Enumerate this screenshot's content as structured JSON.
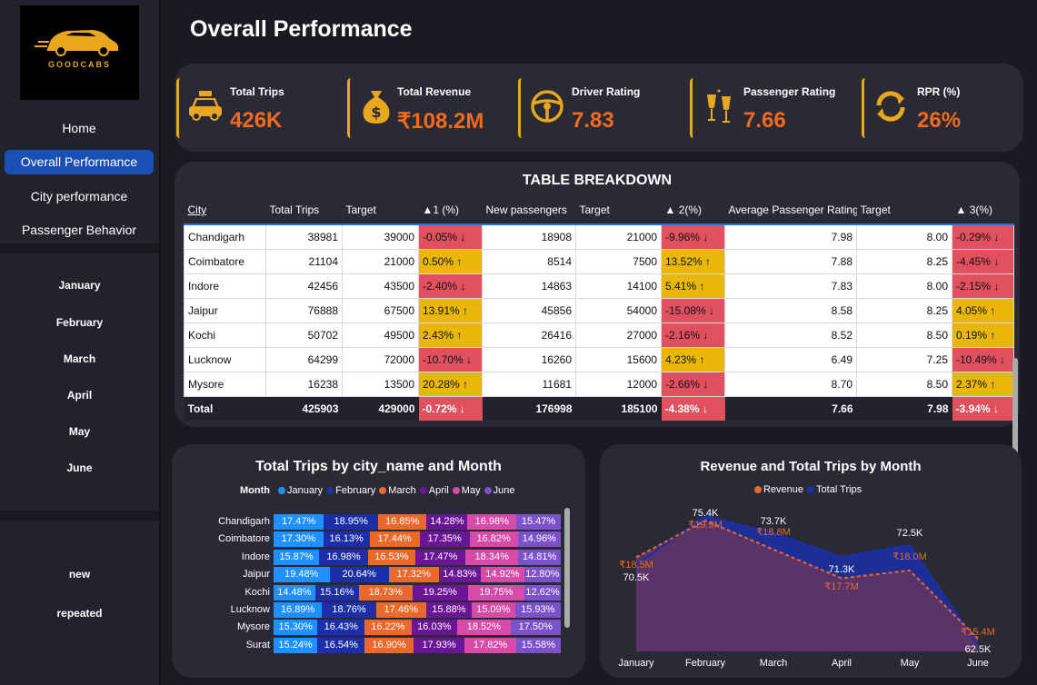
{
  "brand": {
    "wordmark": "GOODCABS"
  },
  "nav": [
    {
      "label": "Home",
      "active": false
    },
    {
      "label": "Overall Performance",
      "active": true
    },
    {
      "label": "City performance",
      "active": false
    },
    {
      "label": "Passenger Behavior",
      "active": false
    }
  ],
  "months": [
    "January",
    "February",
    "March",
    "April",
    "May",
    "June"
  ],
  "passenger_types": [
    "new",
    "repeated"
  ],
  "page_title": "Overall Performance",
  "kpis": [
    {
      "label": "Total Trips",
      "value": "426K",
      "icon": "taxi-icon"
    },
    {
      "label": "Total Revenue",
      "value": "₹108.2M",
      "icon": "money-bag-icon"
    },
    {
      "label": "Driver Rating",
      "value": "7.83",
      "icon": "steering-wheel-icon"
    },
    {
      "label": "Passenger Rating",
      "value": "7.66",
      "icon": "champagne-icon"
    },
    {
      "label": "RPR (%)",
      "value": "26%",
      "icon": "refresh-icon"
    }
  ],
  "table": {
    "title": "TABLE BREAKDOWN",
    "headers": [
      "City",
      "Total Trips",
      "Target",
      "▲1 (%)",
      "New passengers",
      "Target",
      "▲ 2(%)",
      "Average Passenger Rating",
      "Target",
      "▲ 3(%)"
    ],
    "rows": [
      [
        "Chandigarh",
        "38981",
        "39000",
        "-0.05% ↓",
        "18908",
        "21000",
        "-9.96% ↓",
        "7.98",
        "8.00",
        "-0.29% ↓"
      ],
      [
        "Coimbatore",
        "21104",
        "21000",
        "0.50% ↑",
        "8514",
        "7500",
        "13.52% ↑",
        "7.88",
        "8.25",
        "-4.45% ↓"
      ],
      [
        "Indore",
        "42456",
        "43500",
        "-2.40% ↓",
        "14863",
        "14100",
        "5.41% ↑",
        "7.83",
        "8.00",
        "-2.15% ↓"
      ],
      [
        "Jaipur",
        "76888",
        "67500",
        "13.91% ↑",
        "45856",
        "54000",
        "-15.08% ↓",
        "8.58",
        "8.25",
        "4.05% ↑"
      ],
      [
        "Kochi",
        "50702",
        "49500",
        "2.43% ↑",
        "26416",
        "27000",
        "-2.16% ↓",
        "8.52",
        "8.50",
        "0.19% ↑"
      ],
      [
        "Lucknow",
        "64299",
        "72000",
        "-10.70% ↓",
        "16260",
        "15600",
        "4.23% ↑",
        "6.49",
        "7.25",
        "-10.49% ↓"
      ],
      [
        "Mysore",
        "16238",
        "13500",
        "20.28% ↑",
        "11681",
        "12000",
        "-2.66% ↓",
        "8.70",
        "8.50",
        "2.37% ↑"
      ]
    ],
    "total": [
      "Total",
      "425903",
      "429000",
      "-0.72% ↓",
      "176998",
      "185100",
      "-4.38% ↓",
      "7.66",
      "7.98",
      "-3.94% ↓"
    ]
  },
  "colors": {
    "positive": "#e8b70a",
    "negative": "#e0505e",
    "kpi_value": "#f26a1b",
    "accent": "#e8a71c",
    "active_nav": "#1a4fb4"
  },
  "chart_data": [
    {
      "type": "bar",
      "title": "Total Trips by city_name and Month",
      "legend_title": "Month",
      "stacked": "100%",
      "categories": [
        "Chandigarh",
        "Coimbatore",
        "Indore",
        "Jaipur",
        "Kochi",
        "Lucknow",
        "Mysore",
        "Surat"
      ],
      "series": [
        {
          "name": "January",
          "color": "#1e90ff",
          "values": [
            17.47,
            17.3,
            15.87,
            19.48,
            14.48,
            16.89,
            15.3,
            15.24
          ],
          "labels": [
            "17.47%",
            "17.30%",
            "15.87%",
            "19.48%",
            "14.48%",
            "16.89%",
            "15.30%",
            "15.24%"
          ]
        },
        {
          "name": "February",
          "color": "#1c2fa8",
          "values": [
            18.95,
            16.13,
            16.98,
            20.64,
            15.16,
            18.76,
            16.43,
            16.54
          ],
          "labels": [
            "18.95%",
            "16.13%",
            "16.98%",
            "20.64%",
            "15.16%",
            "18.76%",
            "16.43%",
            "16.54%"
          ]
        },
        {
          "name": "March",
          "color": "#e8692a",
          "values": [
            16.85,
            17.44,
            16.53,
            17.32,
            18.73,
            17.46,
            16.22,
            16.9
          ],
          "labels": [
            "16.85%",
            "17.44%",
            "16.53%",
            "17.32%",
            "18.73%",
            "17.46%",
            "16.22%",
            "16.90%"
          ]
        },
        {
          "name": "April",
          "color": "#6a1596",
          "values": [
            14.28,
            17.35,
            17.47,
            14.83,
            19.25,
            15.88,
            16.03,
            17.93
          ],
          "labels": [
            "14.28%",
            "17.35%",
            "17.47%",
            "14.83%",
            "19.25%",
            "15.88%",
            "16.03%",
            "17.93%"
          ]
        },
        {
          "name": "May",
          "color": "#d64ba8",
          "values": [
            16.98,
            16.82,
            18.34,
            14.92,
            19.75,
            15.09,
            18.52,
            17.82
          ],
          "labels": [
            "16.98%",
            "16.82%",
            "18.34%",
            "14.92%",
            "19.75%",
            "15.09%",
            "18.52%",
            "17.82%"
          ]
        },
        {
          "name": "June",
          "color": "#7b52c9",
          "values": [
            15.47,
            14.96,
            14.81,
            12.8,
            12.62,
            15.93,
            17.5,
            15.58
          ],
          "labels": [
            "15.47%",
            "14.96%",
            "14.81%",
            "12.80%",
            "12.62%",
            "15.93%",
            "17.50%",
            "15.58%"
          ]
        }
      ]
    },
    {
      "type": "area",
      "title": "Revenue and Total Trips by Month",
      "categories": [
        "January",
        "February",
        "March",
        "April",
        "May",
        "June"
      ],
      "series": [
        {
          "name": "Revenue",
          "color": "#e8692a",
          "values": [
            18.5,
            19.9,
            18.8,
            17.7,
            18.0,
            15.4
          ],
          "labels": [
            "₹18.5M",
            "₹19.9M",
            "₹18.8M",
            "₹17.7M",
            "₹18.0M",
            "₹15.4M"
          ]
        },
        {
          "name": "Total Trips",
          "color": "#1c2fa8",
          "values": [
            70.5,
            75.4,
            73.7,
            71.3,
            72.5,
            62.5
          ],
          "labels": [
            "70.5K",
            "75.4K",
            "73.7K",
            "71.3K",
            "72.5K",
            "62.5K"
          ]
        }
      ]
    }
  ]
}
